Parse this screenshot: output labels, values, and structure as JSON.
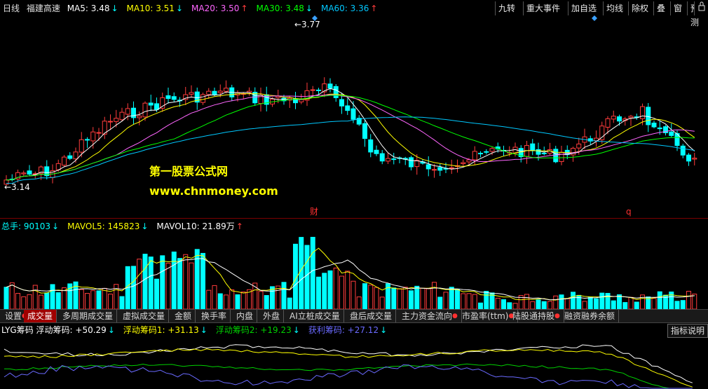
{
  "top_info": {
    "period": "日线",
    "stock": "福建高速",
    "ma": [
      {
        "label": "MA5: 3.48",
        "arrow": "↓",
        "color": "#ffffff",
        "dir": "down"
      },
      {
        "label": "MA10: 3.51",
        "arrow": "↓",
        "color": "#ffff00",
        "dir": "down"
      },
      {
        "label": "MA20: 3.50",
        "arrow": "↑",
        "color": "#ff66ff",
        "dir": "up"
      },
      {
        "label": "MA30: 3.48",
        "arrow": "↓",
        "color": "#00ff00",
        "dir": "down"
      },
      {
        "label": "MA60: 3.36",
        "arrow": "↑",
        "color": "#00c8ff",
        "dir": "up"
      }
    ]
  },
  "toolbar": [
    "九转",
    "重大事件",
    "加自选",
    "均线",
    "除权",
    "叠",
    "窗",
    "预测"
  ],
  "lock_icon": "lock-icon",
  "annotations": {
    "high": "3.77",
    "low": "3.14",
    "marker1": "财",
    "marker2": "q"
  },
  "watermark": {
    "line1": "第一股票公式网",
    "line2": "www.chnmoney.com"
  },
  "vol_info": {
    "items": [
      {
        "label": "总手: 90103",
        "arrow": "↓",
        "color": "#00ffff",
        "dir": "down"
      },
      {
        "label": "MAVOL5: 145823",
        "arrow": "↓",
        "color": "#ffff00",
        "dir": "down"
      },
      {
        "label": "MAVOL10: 21.89万",
        "arrow": "↑",
        "color": "#ffffff",
        "dir": "up"
      }
    ]
  },
  "tabs": [
    {
      "label": "设置",
      "dot": true
    },
    {
      "label": "成交量",
      "active": true
    },
    {
      "label": "多周期成交量"
    },
    {
      "label": "虚拟成交量"
    },
    {
      "label": "金额"
    },
    {
      "label": "换手率"
    },
    {
      "label": "内盘"
    },
    {
      "label": "外盘"
    },
    {
      "label": "AI立桩成交量"
    },
    {
      "label": "盘后成交量"
    },
    {
      "label": "主力资金流向",
      "dot": true
    },
    {
      "label": "市盈率(ttm)",
      "dot": true
    },
    {
      "label": "陆股通持股",
      "dot": true
    },
    {
      "label": "融资融券余额"
    }
  ],
  "ind_info": {
    "items": [
      {
        "label": "LYG筹码 浮动筹码: +50.29",
        "arrow": "↓",
        "color": "#ffffff",
        "dir": "down"
      },
      {
        "label": "浮动筹码1: +31.13",
        "arrow": "↓",
        "color": "#ffff00",
        "dir": "down"
      },
      {
        "label": "浮动筹码2: +19.23",
        "arrow": "↓",
        "color": "#00d000",
        "dir": "down"
      },
      {
        "label": "获利筹码: +27.12",
        "arrow": "↓",
        "color": "#6a6aff",
        "dir": "down"
      }
    ],
    "help_button": "指标说明"
  },
  "colors": {
    "up": "#ff3c3c",
    "down": "#00ffff",
    "separator": "#7a0000"
  }
}
